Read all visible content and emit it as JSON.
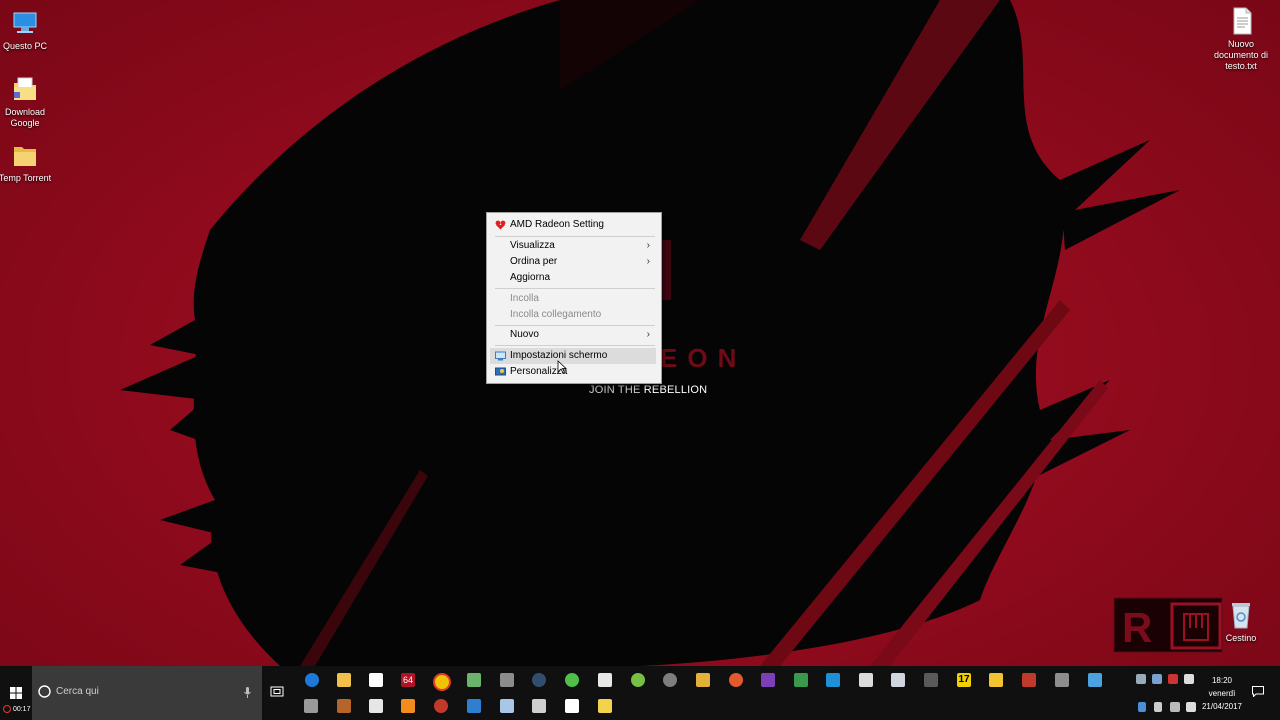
{
  "wallpaper": {
    "brand_text": "EON",
    "tagline_prefix": "JOIN THE",
    "tagline_main": "REBELLION",
    "colors": {
      "base": "#8f0b1c",
      "dark": "#0a0a0a"
    }
  },
  "desktop_icons": [
    {
      "label": "Questo PC",
      "icon": "computer-icon"
    },
    {
      "label": "Download Google",
      "icon": "folder-icon"
    },
    {
      "label": "Temp Torrent",
      "icon": "folder-icon"
    },
    {
      "label": "Nuovo documento di testo.txt",
      "icon": "text-file-icon"
    },
    {
      "label": "Cestino",
      "icon": "recycle-bin-icon"
    }
  ],
  "context_menu": {
    "items": [
      {
        "label": "AMD Radeon Setting",
        "icon": "amd-radeon-icon",
        "submenu": false,
        "disabled": false
      },
      {
        "label": "Visualizza",
        "submenu": true,
        "disabled": false
      },
      {
        "label": "Ordina per",
        "submenu": true,
        "disabled": false
      },
      {
        "label": "Aggiorna",
        "submenu": false,
        "disabled": false
      },
      {
        "label": "Incolla",
        "submenu": false,
        "disabled": true
      },
      {
        "label": "Incolla collegamento",
        "submenu": false,
        "disabled": true
      },
      {
        "label": "Nuovo",
        "submenu": true,
        "disabled": false
      },
      {
        "label": "Impostazioni schermo",
        "icon": "display-icon",
        "submenu": false,
        "disabled": false,
        "hovered": true
      },
      {
        "label": "Personalizza",
        "icon": "personalize-icon",
        "submenu": false,
        "disabled": false
      }
    ],
    "submenu_arrow": "›"
  },
  "taskbar": {
    "search_placeholder": "Cerca qui",
    "recording_time": "00:17",
    "pinned_apps": [
      "edge-icon",
      "file-explorer-icon",
      "store-icon",
      "aida64-icon",
      "chrome-icon",
      "app-icon",
      "app-icon",
      "steam-icon",
      "app-icon",
      "app-icon",
      "utorrent-icon",
      "app-icon",
      "app-icon",
      "app-icon",
      "app-icon",
      "app-icon",
      "app-icon",
      "app-icon",
      "app-icon",
      "app-icon",
      "app-icon",
      "app-icon",
      "app-icon",
      "app-icon",
      "app-icon",
      "app-icon"
    ],
    "clock": {
      "time": "18:20",
      "day": "venerdì",
      "date": "21/04/2017"
    },
    "overlay_number": "17",
    "overlay_label": "64"
  }
}
